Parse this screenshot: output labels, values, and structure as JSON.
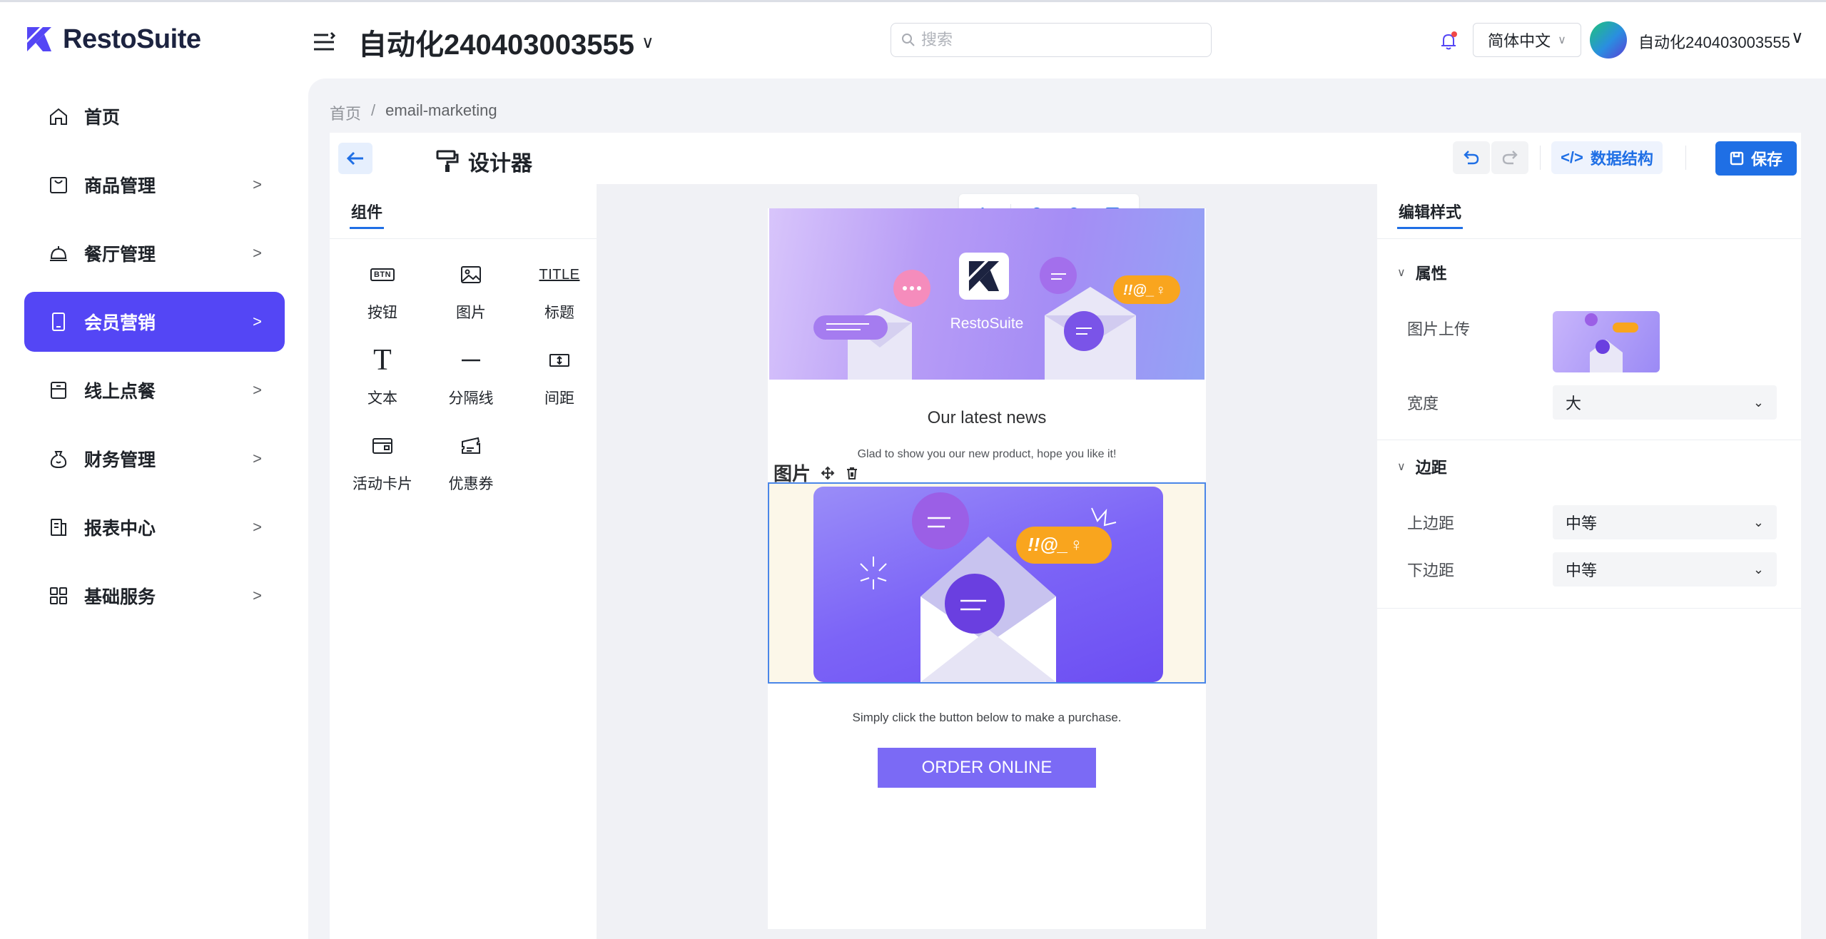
{
  "app": {
    "brand": "RestoSuite",
    "store_title": "自动化240403003555",
    "search_placeholder": "搜索",
    "language": "简体中文",
    "user_name": "自动化240403003555"
  },
  "sidebar": {
    "items": [
      {
        "label": "首页",
        "icon": "home-icon",
        "has_children": false,
        "active": false
      },
      {
        "label": "商品管理",
        "icon": "shopping-bag-icon",
        "has_children": true,
        "active": false
      },
      {
        "label": "餐厅管理",
        "icon": "dining-bell-icon",
        "has_children": true,
        "active": false
      },
      {
        "label": "会员营销",
        "icon": "mobile-icon",
        "has_children": true,
        "active": true
      },
      {
        "label": "线上点餐",
        "icon": "store-icon",
        "has_children": true,
        "active": false
      },
      {
        "label": "财务管理",
        "icon": "money-bag-icon",
        "has_children": true,
        "active": false
      },
      {
        "label": "报表中心",
        "icon": "report-icon",
        "has_children": true,
        "active": false
      },
      {
        "label": "基础服务",
        "icon": "grid-icon",
        "has_children": true,
        "active": false
      }
    ]
  },
  "breadcrumb": {
    "home": "首页",
    "separator": "/",
    "current": "email-marketing"
  },
  "designer": {
    "title": "设计器",
    "schema_button": "数据结构",
    "save_button": "保存"
  },
  "components": {
    "tab": "组件",
    "items": [
      {
        "label": "按钮",
        "icon": "button-icon",
        "icon_text": "BTN"
      },
      {
        "label": "图片",
        "icon": "image-icon"
      },
      {
        "label": "标题",
        "icon": "title-icon",
        "icon_text": "TITLE"
      },
      {
        "label": "文本",
        "icon": "text-icon",
        "icon_text": "T"
      },
      {
        "label": "分隔线",
        "icon": "divider-icon"
      },
      {
        "label": "间距",
        "icon": "spacing-icon"
      },
      {
        "label": "活动卡片",
        "icon": "card-icon"
      },
      {
        "label": "优惠券",
        "icon": "coupon-icon"
      }
    ]
  },
  "email": {
    "hero_brand": "RestoSuite",
    "news_title": "Our latest news",
    "news_subtitle": "Glad to show you our new product, hope you like it!",
    "selected_block_label": "图片",
    "bubble_text": "!!@_♀",
    "purchase_text": "Simply click the button below to make a purchase.",
    "order_button": "ORDER ONLINE"
  },
  "style_panel": {
    "tab": "编辑样式",
    "section_properties": "属性",
    "image_upload_label": "图片上传",
    "width_label": "宽度",
    "width_value": "大",
    "section_margin": "边距",
    "top_margin_label": "上边距",
    "top_margin_value": "中等",
    "bottom_margin_label": "下边距",
    "bottom_margin_value": "中等"
  },
  "colors": {
    "accent": "#1f6fe5",
    "sidebar_active": "#5446f5",
    "order_button": "#7b6af5",
    "selection_border": "#4a86e8"
  }
}
